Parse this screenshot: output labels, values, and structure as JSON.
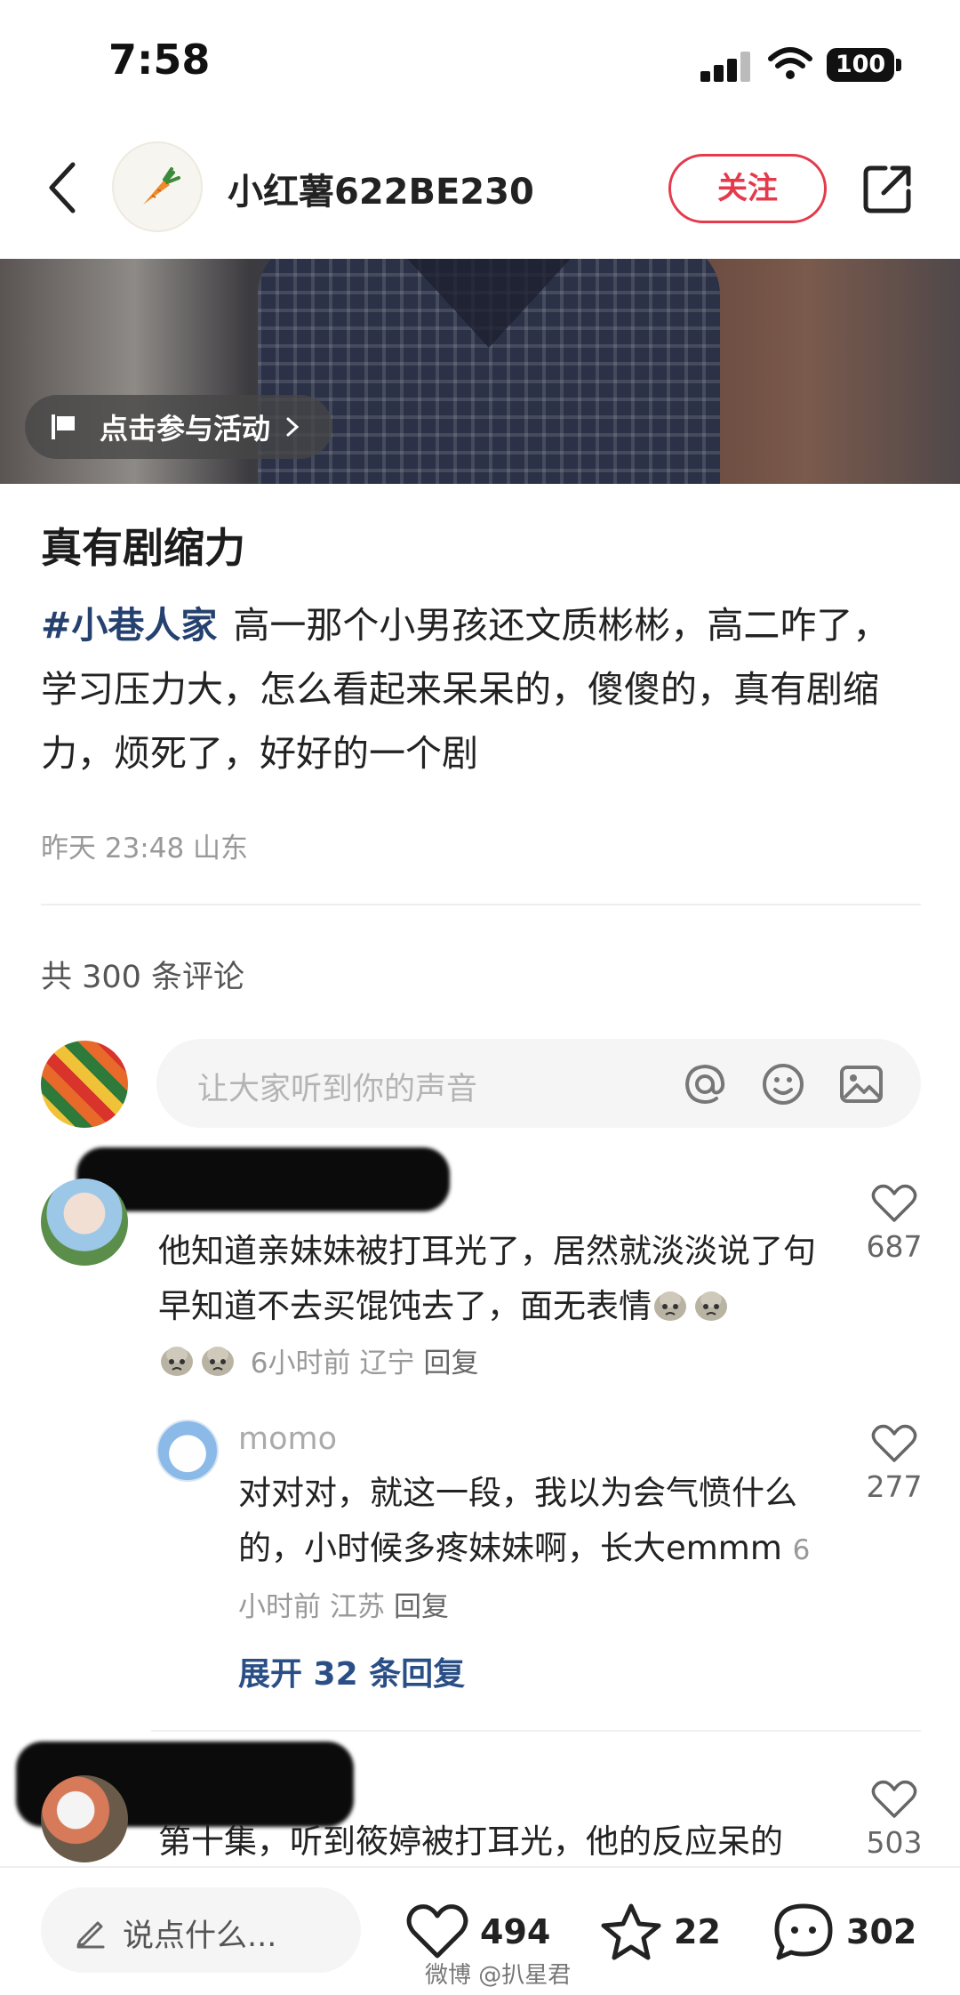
{
  "status_bar": {
    "time": "7:58",
    "battery": "100"
  },
  "header": {
    "author": "小红薯622BE230",
    "follow_label": "关注"
  },
  "hero": {
    "event_label": "点击参与活动"
  },
  "post": {
    "title": "真有剧缩力",
    "hashtag": "#小巷人家",
    "body": "高一那个小男孩还文质彬彬，高二咋了，学习压力大，怎么看起来呆呆的，傻傻的，真有剧缩力，烦死了，好好的一个剧",
    "meta": "昨天 23:48 山东"
  },
  "comments_header": {
    "count_label": "共 300 条评论"
  },
  "comment_input": {
    "placeholder": "让大家听到你的声音"
  },
  "comments": [
    {
      "text": "他知道亲妹妹被打耳光了，居然就淡淡说了句 早知道不去买馄饨去了，面无表情",
      "time": "6小时前",
      "location": "辽宁",
      "reply_label": "回复",
      "likes": "687"
    },
    {
      "user": "momo",
      "text": "对对对，就这一段，我以为会气愤什么的，小时候多疼妹妹啊，长大emmm",
      "time": "6小时前",
      "location": "江苏",
      "reply_label": "回复",
      "likes": "277"
    },
    {
      "text": "第十集，听到筱婷被打耳光，他的反应呆的",
      "likes": "503"
    }
  ],
  "expand_replies": "展开 32 条回复",
  "bottom_bar": {
    "say_placeholder": "说点什么...",
    "likes": "494",
    "favorites": "22",
    "comments": "302"
  },
  "watermark": "微博 @扒星君",
  "colors": {
    "accent_red": "#e43a4b",
    "hashtag_blue": "#24416f",
    "expand_blue": "#2a4e86"
  }
}
